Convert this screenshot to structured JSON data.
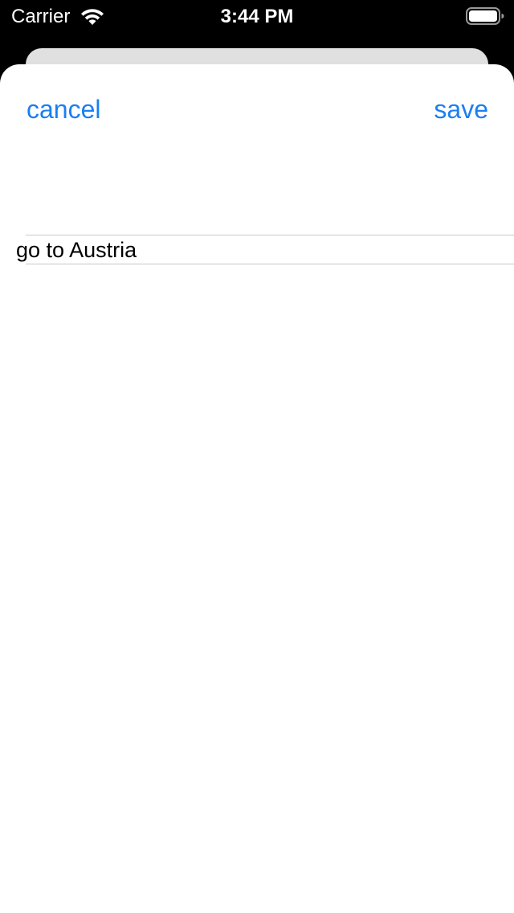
{
  "status_bar": {
    "carrier": "Carrier",
    "time": "3:44 PM",
    "wifi_icon": "wifi-icon",
    "battery_icon": "battery-icon",
    "battery_level": 1.0
  },
  "sheet": {
    "cancel_label": "cancel",
    "save_label": "save",
    "task_field": {
      "value": "go to Austria",
      "placeholder": ""
    }
  },
  "colors": {
    "accent": "#1a7ff0",
    "background": "#000000",
    "sheet": "#ffffff",
    "back_card": "#e0e0e0",
    "separator": "#c8c8cc"
  }
}
